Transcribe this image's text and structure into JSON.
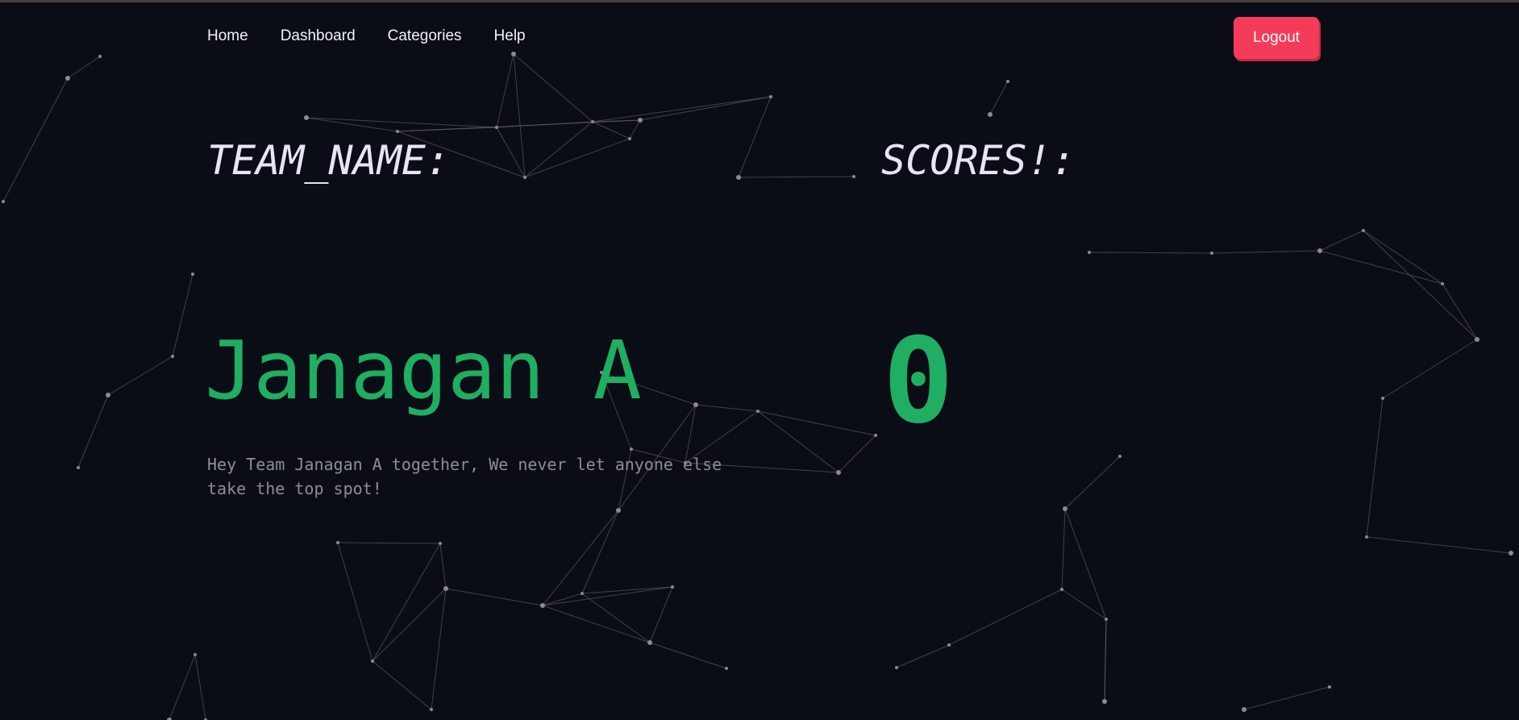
{
  "nav": {
    "items": [
      {
        "label": "Home"
      },
      {
        "label": "Dashboard"
      },
      {
        "label": "Categories"
      },
      {
        "label": "Help"
      }
    ],
    "logout_label": "Logout"
  },
  "headings": {
    "team": "TEAM_NAME:",
    "score": "SCORES!:"
  },
  "team": {
    "name": "Janagan A",
    "score": "0",
    "tagline": "Hey Team Janagan A together, We never let anyone else take the top spot!"
  },
  "colors": {
    "background": "#0b0d16",
    "accent_green": "#1fae62",
    "logout_red": "#f43b5a",
    "heading_text": "#e6e5f7",
    "muted_text": "#8e8c98"
  }
}
